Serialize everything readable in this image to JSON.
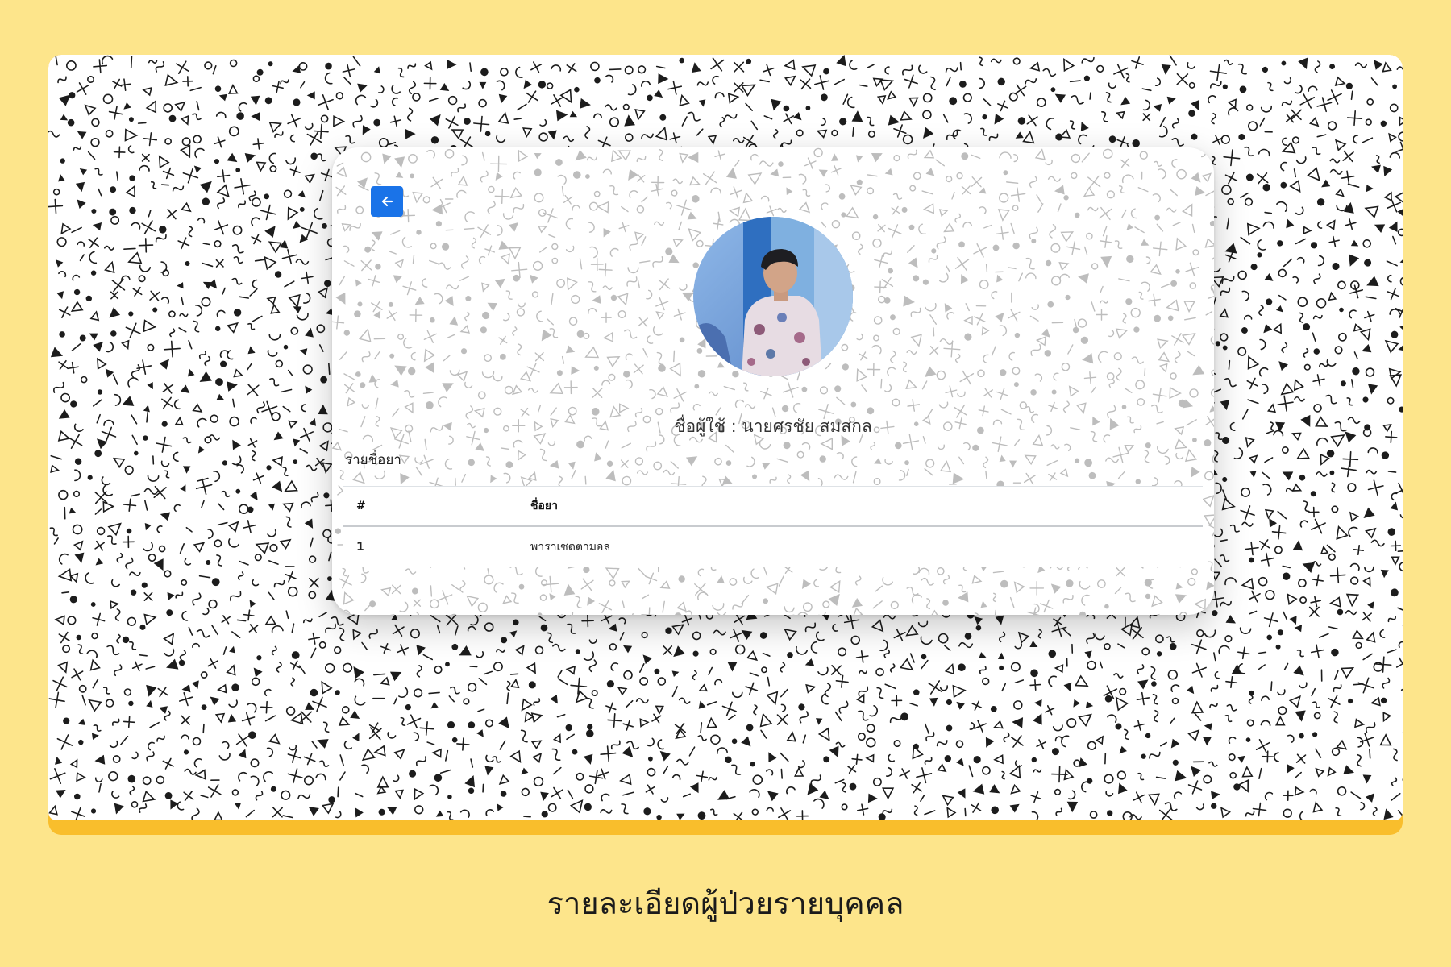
{
  "page": {
    "background_color": "#FDE58B",
    "frame_accent_color": "#F9BE2C",
    "caption": "รายละเอียดผู้ป่วยรายบุคคล"
  },
  "profile": {
    "back_icon": "arrow-left-icon",
    "back_button_color": "#1A73E8",
    "avatar": "user-photo",
    "user_label": "ชื่อผู้ใช้ :",
    "user_name": "นายศรชัย สมสกล"
  },
  "medicines": {
    "section_title": "รายชื่อยา",
    "columns": [
      "#",
      "ชื่อยา"
    ],
    "rows": [
      {
        "index": "1",
        "name": "พาราเซตตามอล"
      }
    ]
  }
}
